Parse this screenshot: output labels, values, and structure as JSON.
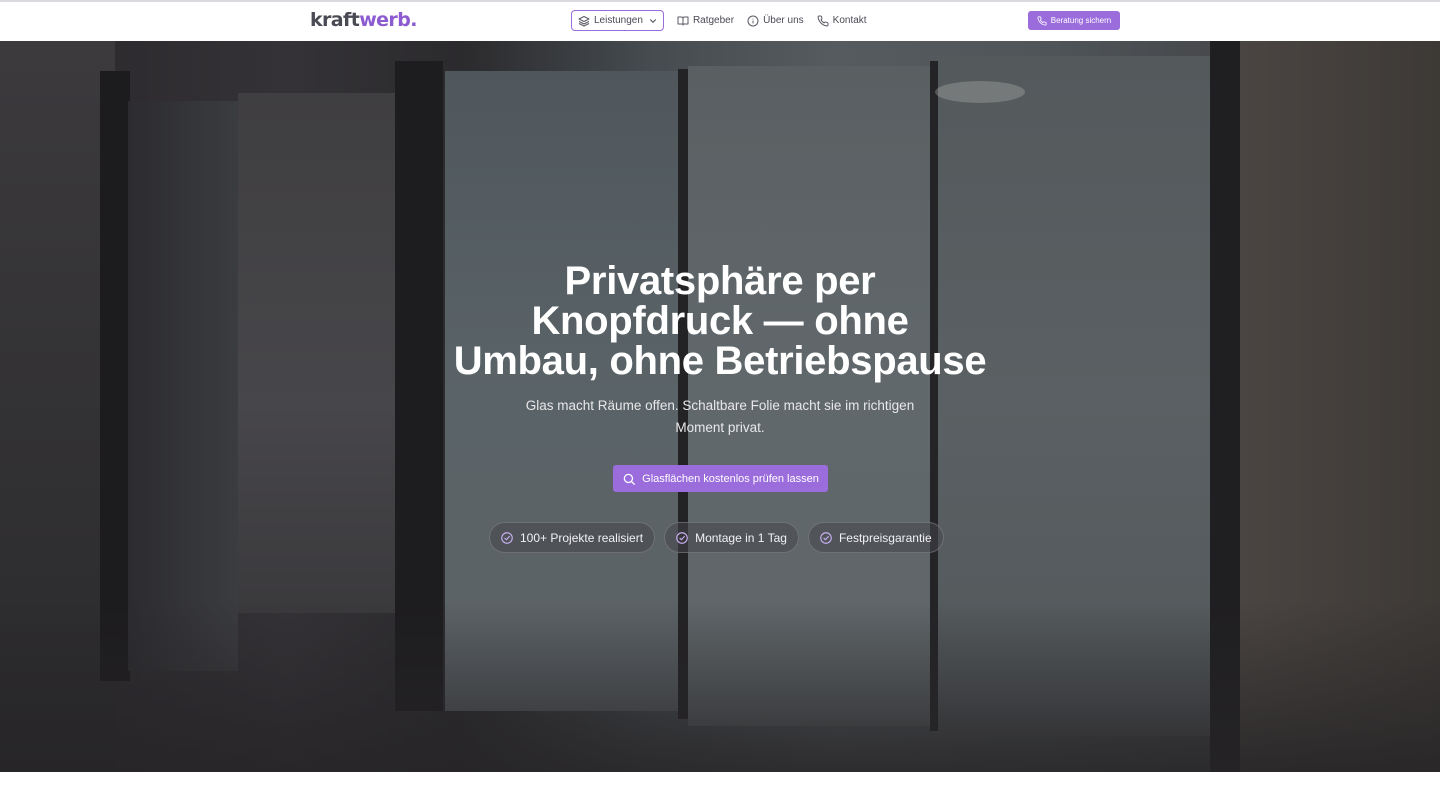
{
  "brand": {
    "logo_part1": "kraft",
    "logo_part2": "werb",
    "logo_part3": ".",
    "accent_color": "#9b6cdc"
  },
  "nav": {
    "items": [
      {
        "label": "Leistungen",
        "icon": "layers-icon",
        "active": true,
        "has_dropdown": true
      },
      {
        "label": "Ratgeber",
        "icon": "book-icon"
      },
      {
        "label": "Über uns",
        "icon": "info-icon"
      },
      {
        "label": "Kontakt",
        "icon": "phone-icon"
      }
    ],
    "cta_label": "Beratung sichern",
    "cta_icon": "phone-icon"
  },
  "hero": {
    "title_line1": "Privatsphäre per",
    "title_line2": "Knopfdruck — ohne",
    "title_line3": "Umbau, ohne Betriebspause",
    "subtitle_line1": "Glas macht Räume offen. Schaltbare Folie macht sie im richtigen",
    "subtitle_line2": "Moment privat.",
    "cta_label": "Glasflächen kostenlos prüfen lassen",
    "cta_icon": "search-icon",
    "badges": [
      {
        "label": "100+ Projekte realisiert",
        "icon": "check-circle-icon"
      },
      {
        "label": "Montage in 1 Tag",
        "icon": "check-circle-icon"
      },
      {
        "label": "Festpreisgarantie",
        "icon": "check-circle-icon"
      }
    ]
  }
}
